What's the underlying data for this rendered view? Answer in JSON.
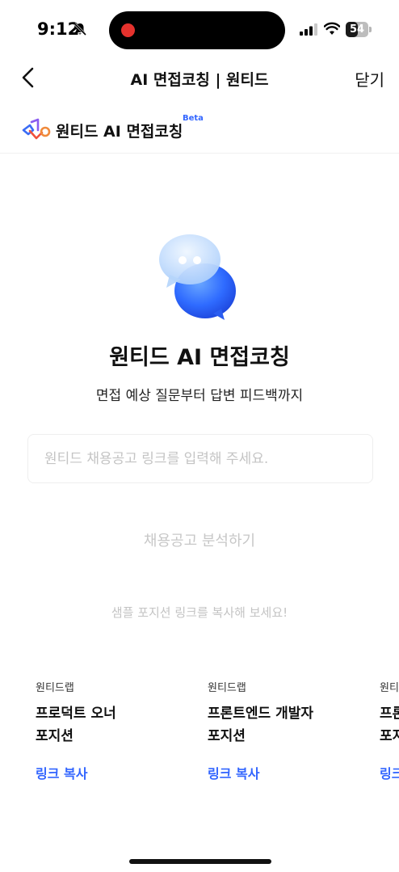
{
  "status_bar": {
    "time": "9:12",
    "battery": "54",
    "battery_fraction": 0.54,
    "icons": [
      "bell-off-icon",
      "signal-icon",
      "wifi-icon",
      "battery-icon"
    ]
  },
  "nav": {
    "title": "AI 면접코칭 | 원티드",
    "close_label": "닫기",
    "back_icon": "chevron-left-icon"
  },
  "brand": {
    "name": "원티드 AI 면접코칭",
    "badge": "Beta",
    "logo_icon": "wanted-logo-icon"
  },
  "hero": {
    "icon": "chat-bubbles-icon",
    "title": "원티드 AI 면접코칭",
    "subtitle": "면접 예상 질문부터 답변 피드백까지"
  },
  "form": {
    "url_placeholder": "원티드 채용공고 링크를 입력해 주세요.",
    "url_value": "",
    "analyze_label": "채용공고 분석하기"
  },
  "samples": {
    "hint": "샘플 포지션 링크를 복사해 보세요!",
    "cards": [
      {
        "company": "원티드랩",
        "title_line1": "프로덕트 오너",
        "title_line2": "포지션",
        "link_label": "링크 복사"
      },
      {
        "company": "원티드랩",
        "title_line1": "프론트엔드 개발자",
        "title_line2": "포지션",
        "link_label": "링크 복사"
      },
      {
        "company": "원티드랩",
        "title_line1": "프론트엔드 개발자",
        "title_line2": "포지션",
        "link_label": "링크 복사"
      }
    ]
  },
  "colors": {
    "accent": "#3366ff",
    "placeholder": "#c4c4c4",
    "disabled_text": "#c7c7c7"
  }
}
